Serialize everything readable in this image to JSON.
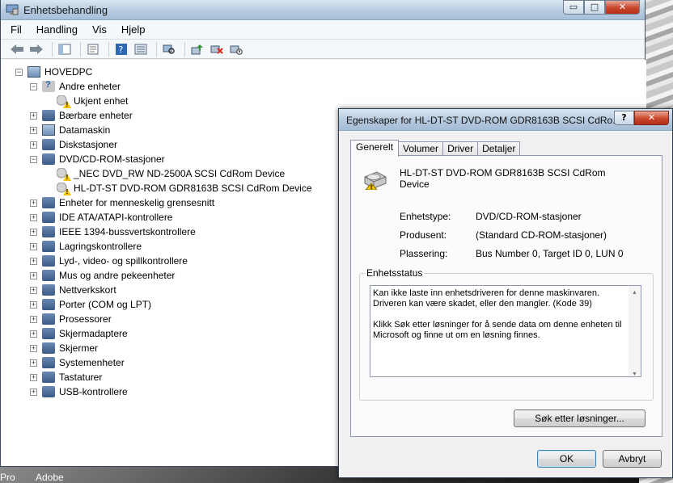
{
  "main_window": {
    "title": "Enhetsbehandling",
    "caption_buttons": {
      "minimize": "▭",
      "maximize": "□",
      "close": "✕"
    },
    "menu": [
      "Fil",
      "Handling",
      "Vis",
      "Hjelp"
    ],
    "tree": [
      {
        "label": "HOVEDPC",
        "level": 0,
        "expander": "−",
        "icon": "computer-icon"
      },
      {
        "label": "Andre enheter",
        "level": 1,
        "expander": "−",
        "icon": "unknown-device-icon"
      },
      {
        "label": "Ukjent enhet",
        "level": 2,
        "expander": "",
        "icon": "warning-device-icon"
      },
      {
        "label": "Bærbare enheter",
        "level": 1,
        "expander": "+",
        "icon": "portable-devices-icon"
      },
      {
        "label": "Datamaskin",
        "level": 1,
        "expander": "+",
        "icon": "computer-icon"
      },
      {
        "label": "Diskstasjoner",
        "level": 1,
        "expander": "+",
        "icon": "disk-drive-icon"
      },
      {
        "label": "DVD/CD-ROM-stasjoner",
        "level": 1,
        "expander": "−",
        "icon": "cdrom-icon"
      },
      {
        "label": "_NEC DVD_RW ND-2500A SCSI CdRom Device",
        "level": 2,
        "expander": "",
        "icon": "warning-device-icon"
      },
      {
        "label": "HL-DT-ST DVD-ROM GDR8163B SCSI CdRom Device",
        "level": 2,
        "expander": "",
        "icon": "warning-device-icon"
      },
      {
        "label": "Enheter for menneskelig grensesnitt",
        "level": 1,
        "expander": "+",
        "icon": "hid-icon"
      },
      {
        "label": "IDE ATA/ATAPI-kontrollere",
        "level": 1,
        "expander": "+",
        "icon": "ide-controller-icon"
      },
      {
        "label": "IEEE 1394-bussvertskontrollere",
        "level": 1,
        "expander": "+",
        "icon": "firewire-icon"
      },
      {
        "label": "Lagringskontrollere",
        "level": 1,
        "expander": "+",
        "icon": "storage-controller-icon"
      },
      {
        "label": "Lyd-, video- og spillkontrollere",
        "level": 1,
        "expander": "+",
        "icon": "sound-icon"
      },
      {
        "label": "Mus og andre pekeenheter",
        "level": 1,
        "expander": "+",
        "icon": "mouse-icon"
      },
      {
        "label": "Nettverkskort",
        "level": 1,
        "expander": "+",
        "icon": "network-adapter-icon"
      },
      {
        "label": "Porter (COM og LPT)",
        "level": 1,
        "expander": "+",
        "icon": "port-icon"
      },
      {
        "label": "Prosessorer",
        "level": 1,
        "expander": "+",
        "icon": "processor-icon"
      },
      {
        "label": "Skjermadaptere",
        "level": 1,
        "expander": "+",
        "icon": "display-adapter-icon"
      },
      {
        "label": "Skjermer",
        "level": 1,
        "expander": "+",
        "icon": "monitor-icon"
      },
      {
        "label": "Systemenheter",
        "level": 1,
        "expander": "+",
        "icon": "system-devices-icon"
      },
      {
        "label": "Tastaturer",
        "level": 1,
        "expander": "+",
        "icon": "keyboard-icon"
      },
      {
        "label": "USB-kontrollere",
        "level": 1,
        "expander": "+",
        "icon": "usb-icon"
      }
    ]
  },
  "dialog": {
    "title": "Egenskaper for HL-DT-ST DVD-ROM GDR8163B SCSI CdRo...",
    "help_label": "?",
    "close_label": "✕",
    "tabs": [
      "Generelt",
      "Volumer",
      "Driver",
      "Detaljer"
    ],
    "device_name_line1": "HL-DT-ST DVD-ROM GDR8163B SCSI CdRom",
    "device_name_line2": "Device",
    "properties": [
      {
        "label": "Enhetstype:",
        "value": "DVD/CD-ROM-stasjoner"
      },
      {
        "label": "Produsent:",
        "value": "(Standard CD-ROM-stasjoner)"
      },
      {
        "label": "Plassering:",
        "value": "Bus Number 0, Target ID 0, LUN 0"
      }
    ],
    "status_group_label": "Enhetsstatus",
    "status_para1": "Kan ikke laste inn enhetsdriveren for denne maskinvaren. Driveren kan være skadet, eller den mangler. (Kode 39)",
    "status_para2": "Klikk Søk etter løsninger for å sende data om denne enheten til Microsoft og finne ut om en løsning finnes.",
    "search_button": "Søk etter løsninger...",
    "ok_button": "OK",
    "cancel_button": "Avbryt"
  },
  "taskbar": {
    "left_label": "Pro",
    "right_label": "Adobe"
  }
}
